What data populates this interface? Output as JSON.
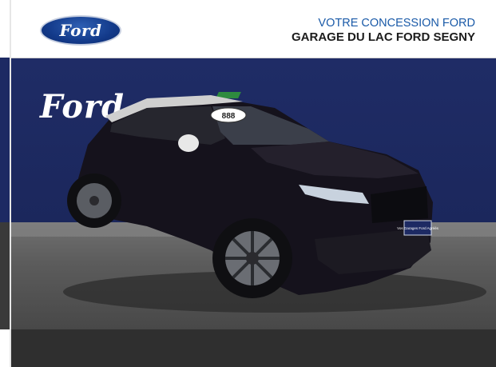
{
  "header": {
    "brand_logo_text": "Ford",
    "dealer_tagline": "VOTRE CONCESSION FORD",
    "dealer_name": "GARAGE DU LAC FORD SEGNY"
  },
  "photo": {
    "wall_logo_text": "Ford",
    "plate_text": "Vos Garages Ford Agréés",
    "windshield_sticker": "888"
  },
  "colors": {
    "ford_blue": "#133a8a",
    "wall_navy": "#1f2c66",
    "tagline_blue": "#1a5aa8",
    "car_black": "#15121c"
  }
}
